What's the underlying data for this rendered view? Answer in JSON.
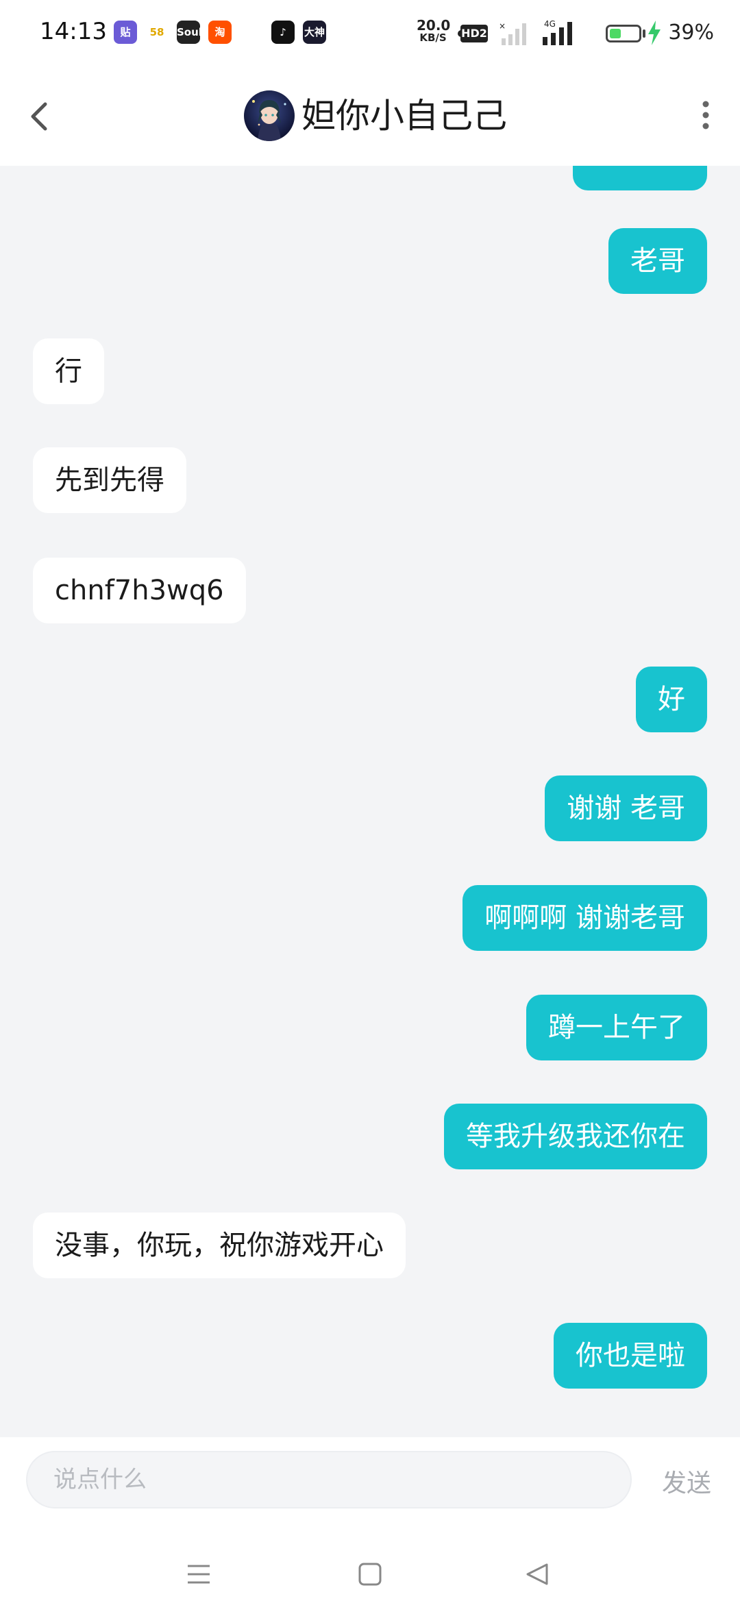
{
  "status_bar": {
    "time": "14:13",
    "net_speed_value": "20.0",
    "net_speed_unit": "KB/S",
    "hd_label": "HD2",
    "network_label": "4G",
    "battery_percent": "39%",
    "battery_level": 0.39,
    "notification_apps": [
      {
        "name": "tieba-icon",
        "label": "贴",
        "color": "#6b5bd6"
      },
      {
        "name": "app-58-icon",
        "label": "58",
        "color": "#ffffff"
      },
      {
        "name": "soul-icon",
        "label": "Soul",
        "color": "#222222"
      },
      {
        "name": "taobao-icon",
        "label": "淘",
        "color": "#ff5000"
      },
      {
        "name": "weibo-icon",
        "label": "",
        "color": "#ffffff"
      },
      {
        "name": "tiktok-icon",
        "label": "♪",
        "color": "#111111"
      },
      {
        "name": "dashen-icon",
        "label": "大神",
        "color": "#1a1a2e"
      }
    ]
  },
  "header": {
    "title": "妲你小自己己"
  },
  "messages": [
    {
      "side": "out",
      "text": "老哥"
    },
    {
      "side": "in",
      "text": "行"
    },
    {
      "side": "in",
      "text": "先到先得"
    },
    {
      "side": "in",
      "text": "chnf7h3wq6"
    },
    {
      "side": "out",
      "text": "好"
    },
    {
      "side": "out",
      "text": "谢谢 老哥"
    },
    {
      "side": "out",
      "text": "啊啊啊 谢谢老哥"
    },
    {
      "side": "out",
      "text": "蹲一上午了"
    },
    {
      "side": "out",
      "text": "等我升级我还你在"
    },
    {
      "side": "in",
      "text": "没事，你玩，祝你游戏开心"
    },
    {
      "side": "out",
      "text": "你也是啦"
    }
  ],
  "input": {
    "placeholder": "说点什么",
    "send_label": "发送"
  },
  "colors": {
    "outgoing_bubble": "#18c3cf",
    "incoming_bubble": "#ffffff",
    "background": "#f3f4f6"
  }
}
